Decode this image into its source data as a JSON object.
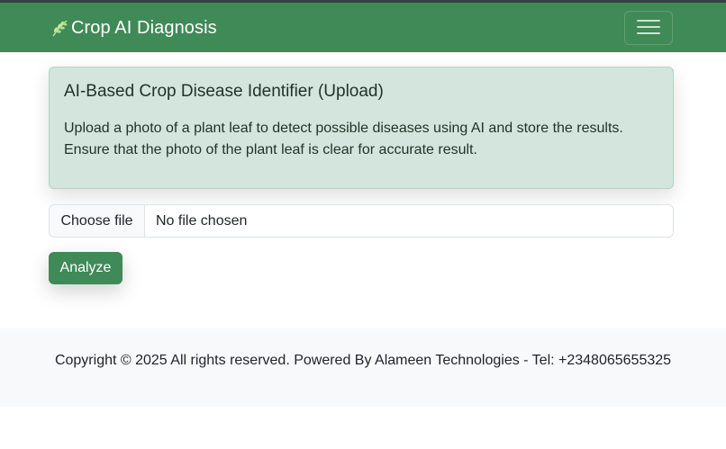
{
  "navbar": {
    "brand_icon": "leaf-icon",
    "brand_text": "Crop AI Diagnosis",
    "toggle_icon": "hamburger-menu-icon",
    "background_color": "#3f8a56"
  },
  "info_card": {
    "title": "AI-Based Crop Disease Identifier (Upload)",
    "text": "Upload a photo of a plant leaf to detect possible diseases using AI and store the results. Ensure that the photo of the plant leaf is clear for accurate result.",
    "background_color": "#d3e5dc"
  },
  "upload": {
    "button_label": "Choose file",
    "status_text": "No file chosen"
  },
  "actions": {
    "analyze_label": "Analyze",
    "analyze_color": "#3f8a56"
  },
  "footer": {
    "text": "Copyright © 2025 All rights reserved. Powered By Alameen Technologies - Tel: +2348065655325"
  }
}
